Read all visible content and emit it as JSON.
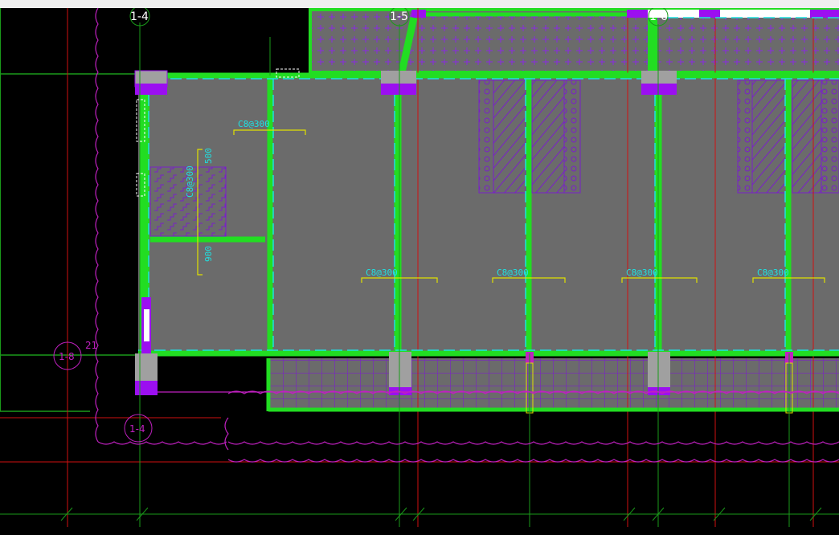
{
  "grid_labels": {
    "a": "1-4",
    "b": "1-5",
    "c": "1-6",
    "d": "1-8",
    "e": "1-4",
    "f": "21"
  },
  "rebar_labels": [
    "C8@300",
    "C8@300",
    "C8@300",
    "C8@300",
    "C8@300",
    "C8@300"
  ],
  "dims": {
    "top": "500",
    "bottom": "900"
  },
  "colors": {
    "background": "#000000",
    "slab": "#6b6b6b",
    "beam": "#22dd22",
    "column": "#9b0ff0",
    "hatch": "#7a20c8",
    "rebar": "#20e0e0",
    "yellow": "#e0e000",
    "redline": "#d01010",
    "revcloud": "#c020c0"
  }
}
